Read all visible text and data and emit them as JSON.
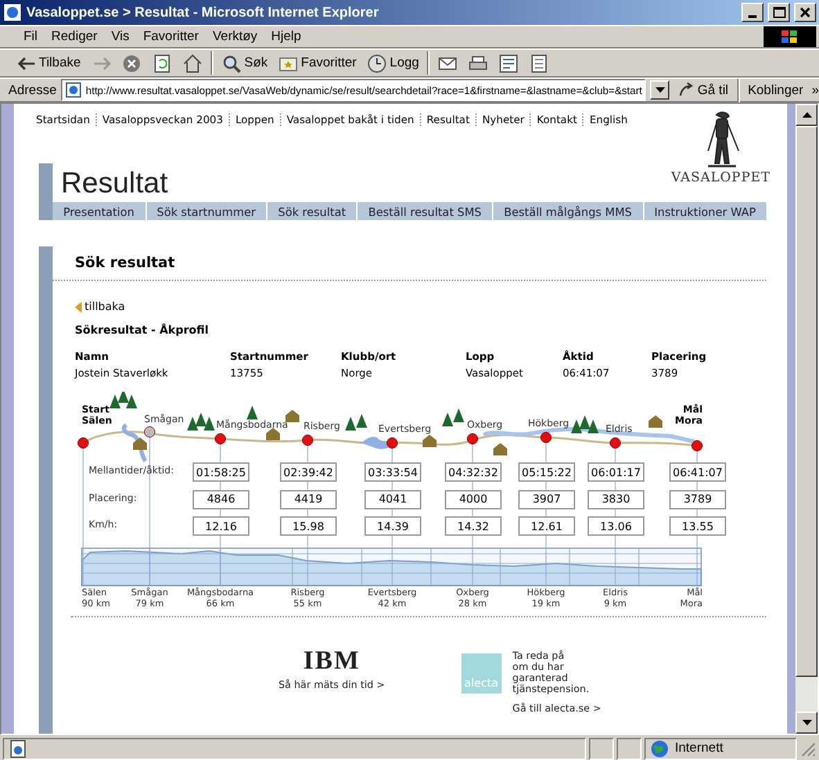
{
  "window": {
    "title": "Vasaloppet.se > Resultat - Microsoft Internet Explorer"
  },
  "menu": [
    "Fil",
    "Rediger",
    "Vis",
    "Favoritter",
    "Verktøy",
    "Hjelp"
  ],
  "toolbar": [
    {
      "kind": "back",
      "label": "Tilbake"
    },
    {
      "kind": "forward"
    },
    {
      "kind": "stop"
    },
    {
      "kind": "refresh"
    },
    {
      "kind": "home"
    },
    {
      "kind": "search",
      "label": "Søk"
    },
    {
      "kind": "favorites",
      "label": "Favoritter"
    },
    {
      "kind": "history",
      "label": "Logg"
    },
    {
      "kind": "mail"
    },
    {
      "kind": "print"
    },
    {
      "kind": "edit"
    },
    {
      "kind": "note"
    }
  ],
  "address_bar": {
    "label": "Adresse",
    "url": "http://www.resultat.vasaloppet.se/VasaWeb/dynamic/se/result/searchdetail?race=1&firstname=&lastname=&club=&start",
    "go": "Gå til",
    "links": "Koblinger",
    "more": "»"
  },
  "site_nav": [
    "Startsidan",
    "Vasaloppsveckan 2003",
    "Loppen",
    "Vasaloppet bakåt i tiden",
    "Resultat",
    "Nyheter",
    "Kontakt",
    "English"
  ],
  "logo": {
    "text": "VASALOPPET"
  },
  "page_title": "Resultat",
  "tabs": [
    {
      "label": "Presentation",
      "selected": false
    },
    {
      "label": "Sök startnummer",
      "selected": false
    },
    {
      "label": "Sök resultat",
      "selected": false
    },
    {
      "label": "Beställ resultat SMS",
      "selected": false
    },
    {
      "label": "Beställ målgångs MMS",
      "selected": false
    },
    {
      "label": "Instruktioner WAP",
      "selected": false
    }
  ],
  "section": {
    "title": "Sök resultat",
    "back_link": "tillbaka",
    "subtitle": "Sökresultat - Åkprofil",
    "result": {
      "columns": [
        "Namn",
        "Startnummer",
        "Klubb/ort",
        "Lopp",
        "Åktid",
        "Placering"
      ],
      "values": [
        "Jostein Staverløkk",
        "13755",
        "Norge",
        "Vasaloppet",
        "06:41:07",
        "3789"
      ]
    },
    "profile": {
      "row_labels": [
        "Mellantider/åktid:",
        "Placering:",
        "Km/h:"
      ],
      "stations": [
        {
          "kind": "start",
          "top": [
            "Start",
            "Sälen"
          ],
          "bottom": [
            "Sälen",
            "90 km"
          ]
        },
        {
          "kind": "passing",
          "top": [
            "Smågan"
          ],
          "bottom": [
            "Smågan",
            "79 km"
          ]
        },
        {
          "kind": "control",
          "top": [
            "Mångsbodarna"
          ],
          "bottom": [
            "Mångsbodarna",
            "66 km"
          ],
          "time": "01:58:25",
          "place": "4846",
          "speed": "12.16"
        },
        {
          "kind": "control",
          "top": [
            "Risberg"
          ],
          "bottom": [
            "Risberg",
            "55 km"
          ],
          "time": "02:39:42",
          "place": "4419",
          "speed": "15.98"
        },
        {
          "kind": "control",
          "top": [
            "Evertsberg"
          ],
          "bottom": [
            "Evertsberg",
            "42 km"
          ],
          "time": "03:33:54",
          "place": "4041",
          "speed": "14.39"
        },
        {
          "kind": "control",
          "top": [
            "Oxberg"
          ],
          "bottom": [
            "Oxberg",
            "28 km"
          ],
          "time": "04:32:32",
          "place": "4000",
          "speed": "14.32"
        },
        {
          "kind": "control",
          "top": [
            "Hökberg"
          ],
          "bottom": [
            "Hökberg",
            "19 km"
          ],
          "time": "05:15:22",
          "place": "3907",
          "speed": "12.61"
        },
        {
          "kind": "control",
          "top": [
            "Eldris"
          ],
          "bottom": [
            "Eldris",
            "9 km"
          ],
          "time": "06:01:17",
          "place": "3830",
          "speed": "13.06"
        },
        {
          "kind": "finish",
          "top": [
            "Mål",
            "Mora"
          ],
          "bottom": [
            "Mål",
            "Mora"
          ],
          "time": "06:41:07",
          "place": "3789",
          "speed": "13.55"
        }
      ]
    }
  },
  "ads": [
    {
      "kind": "ibm",
      "logo": "IBM",
      "link": "Så här mäts din tid >"
    },
    {
      "kind": "alecta",
      "logo": "alecta",
      "lines": [
        "Ta reda på",
        "om du har",
        "garanterad",
        "tjänstepension."
      ],
      "link": "Gå till alecta.se >"
    }
  ],
  "status_bar": {
    "zone": "Internett"
  }
}
